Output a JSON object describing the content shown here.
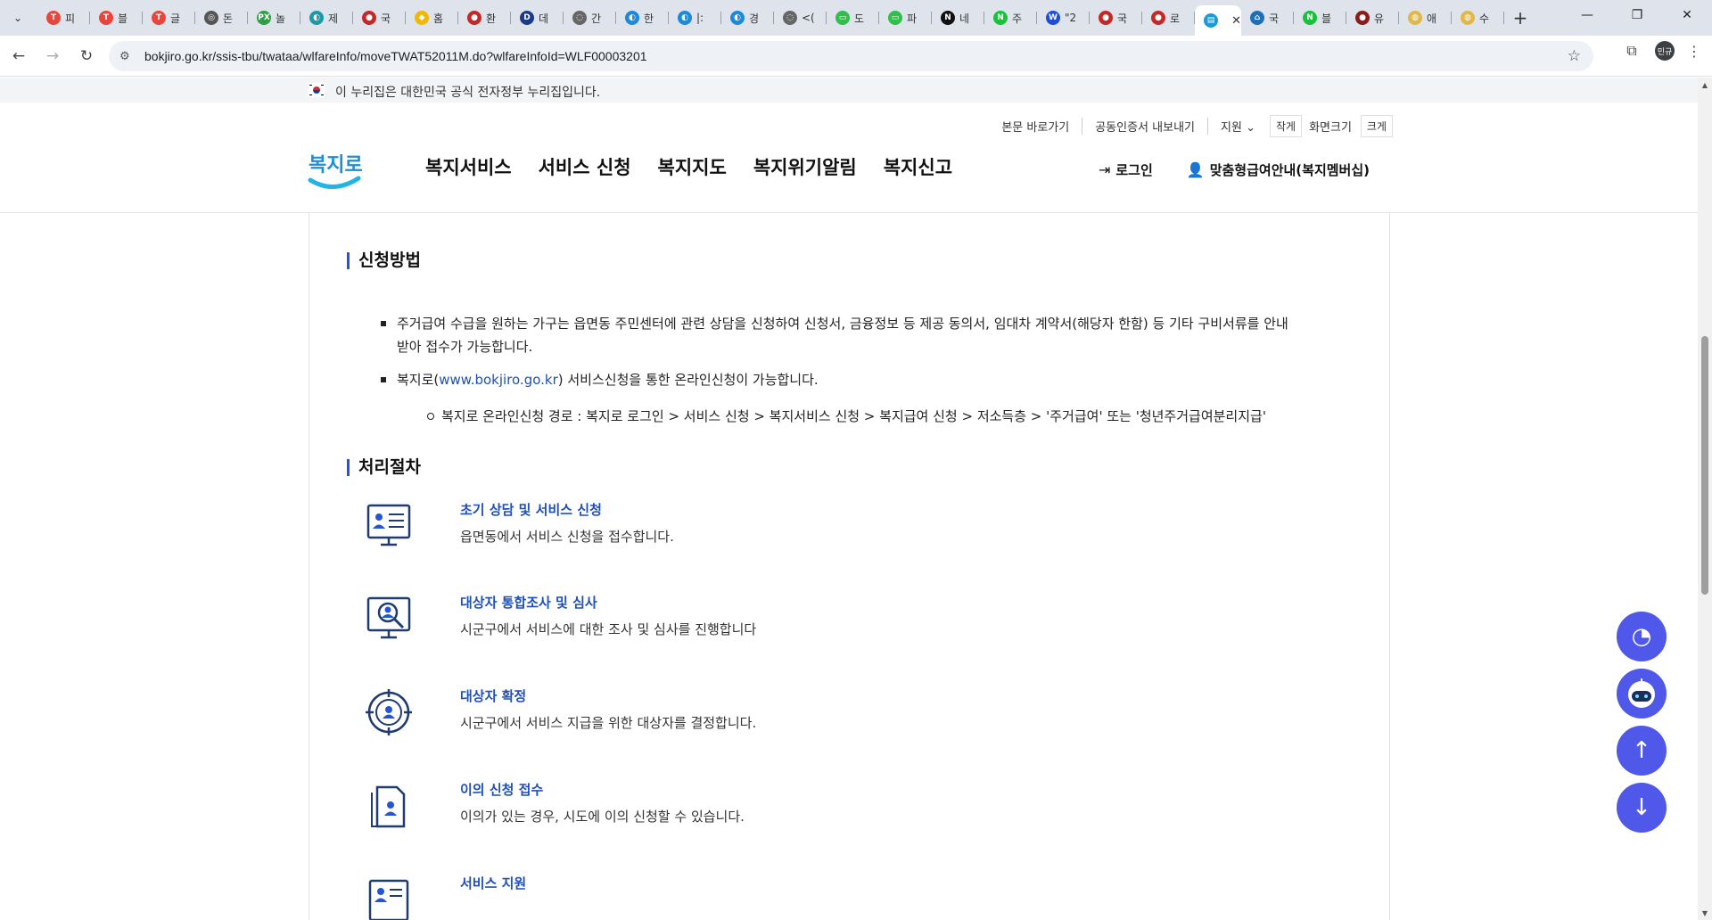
{
  "browser": {
    "tabs": [
      {
        "fav_color": "#e8453c",
        "fav_glyph": "T",
        "title": "피"
      },
      {
        "fav_color": "#e8453c",
        "fav_glyph": "T",
        "title": "블"
      },
      {
        "fav_color": "#e8453c",
        "fav_glyph": "T",
        "title": "글"
      },
      {
        "fav_color": "#555555",
        "fav_glyph": "◎",
        "title": "돈"
      },
      {
        "fav_color": "#2f9e44",
        "fav_glyph": "PX",
        "title": "놀"
      },
      {
        "fav_color": "#1c9aa8",
        "fav_glyph": "◐",
        "title": "제"
      },
      {
        "fav_color": "#c62828",
        "fav_glyph": "●",
        "title": "국"
      },
      {
        "fav_color": "#f2b705",
        "fav_glyph": "◆",
        "title": "홈"
      },
      {
        "fav_color": "#c62828",
        "fav_glyph": "●",
        "title": "환"
      },
      {
        "fav_color": "#1e3a8a",
        "fav_glyph": "D",
        "title": "데"
      },
      {
        "fav_color": "#666666",
        "fav_glyph": "◌",
        "title": "간"
      },
      {
        "fav_color": "#1c8adb",
        "fav_glyph": "◐",
        "title": "한"
      },
      {
        "fav_color": "#1c8adb",
        "fav_glyph": "◐",
        "title": "|:"
      },
      {
        "fav_color": "#1c8adb",
        "fav_glyph": "◐",
        "title": "경"
      },
      {
        "fav_color": "#666666",
        "fav_glyph": "◌",
        "title": "<("
      },
      {
        "fav_color": "#2fbf4a",
        "fav_glyph": "▭",
        "title": "도"
      },
      {
        "fav_color": "#2fbf4a",
        "fav_glyph": "▭",
        "title": "파"
      },
      {
        "fav_color": "#111111",
        "fav_glyph": "N",
        "title": "네"
      },
      {
        "fav_color": "#19c23b",
        "fav_glyph": "N",
        "title": "주"
      },
      {
        "fav_color": "#1d4ed8",
        "fav_glyph": "W",
        "title": "\"2"
      },
      {
        "fav_color": "#c62828",
        "fav_glyph": "●",
        "title": "국"
      },
      {
        "fav_color": "#c62828",
        "fav_glyph": "●",
        "title": "로"
      },
      {
        "fav_color": "#1c9ad6",
        "fav_glyph": "▤",
        "title": "",
        "active": true
      },
      {
        "fav_color": "#1d6fb8",
        "fav_glyph": "⌂",
        "title": "국"
      },
      {
        "fav_color": "#19c23b",
        "fav_glyph": "N",
        "title": "블"
      },
      {
        "fav_color": "#8b1c1c",
        "fav_glyph": "●",
        "title": "유"
      },
      {
        "fav_color": "#e0b84a",
        "fav_glyph": "◍",
        "title": "애"
      },
      {
        "fav_color": "#e0b84a",
        "fav_glyph": "◍",
        "title": "수"
      }
    ],
    "url": "bokjiro.go.kr/ssis-tbu/twataa/wlfareInfo/moveTWAT52011M.do?wlfareInfoId=WLF00003201",
    "profile_label": "민규"
  },
  "page": {
    "gov_banner": "이 누리집은 대한민국 공식 전자정부 누리집입니다.",
    "util_links": {
      "skip": "본문 바로가기",
      "cert": "공동인증서 내보내기",
      "support": "지원",
      "small": "작게",
      "font_size": "화면크기",
      "large": "크게"
    },
    "logo_text": "복지로",
    "gnb": [
      "복지서비스",
      "서비스 신청",
      "복지지도",
      "복지위기알림",
      "복지신고"
    ],
    "login": "로그인",
    "membership": "맞춤형급여안내(복지멤버십)",
    "apply": {
      "title": "신청방법",
      "bullet1": "주거급여 수급을 원하는 가구는 읍면동 주민센터에 관련 상담을 신청하여 신청서, 금융정보 등 제공 동의서, 임대차 계약서(해당자 한함) 등 기타 구비서류를 안내받아 접수가 가능합니다.",
      "bullet2_pre": "복지로(",
      "bullet2_link": "www.bokjiro.go.kr",
      "bullet2_post": ") 서비스신청을 통한 온라인신청이 가능합니다.",
      "sub_bullet": "복지로 온라인신청 경로 : 복지로 로그인 > 서비스 신청 > 복지서비스 신청 > 복지급여 신청 > 저소득층 > '주거급여' 또는 '청년주거급여분리지급'"
    },
    "process": {
      "title": "처리절차",
      "steps": [
        {
          "title": "초기 상담 및 서비스 신청",
          "desc": "읍면동에서 서비스 신청을 접수합니다."
        },
        {
          "title": "대상자 통합조사 및 심사",
          "desc": "시군구에서 서비스에 대한 조사 및 심사를 진행합니다"
        },
        {
          "title": "대상자 확정",
          "desc": "시군구에서 서비스 지급을 위한 대상자를 결정합니다."
        },
        {
          "title": "이의 신청 접수",
          "desc": "이의가 있는 경우, 시도에 이의 신청할 수 있습니다."
        },
        {
          "title": "서비스 지원",
          "desc": ""
        }
      ]
    },
    "accent_color": "#2456d3",
    "fab_color": "#4f58e8"
  }
}
